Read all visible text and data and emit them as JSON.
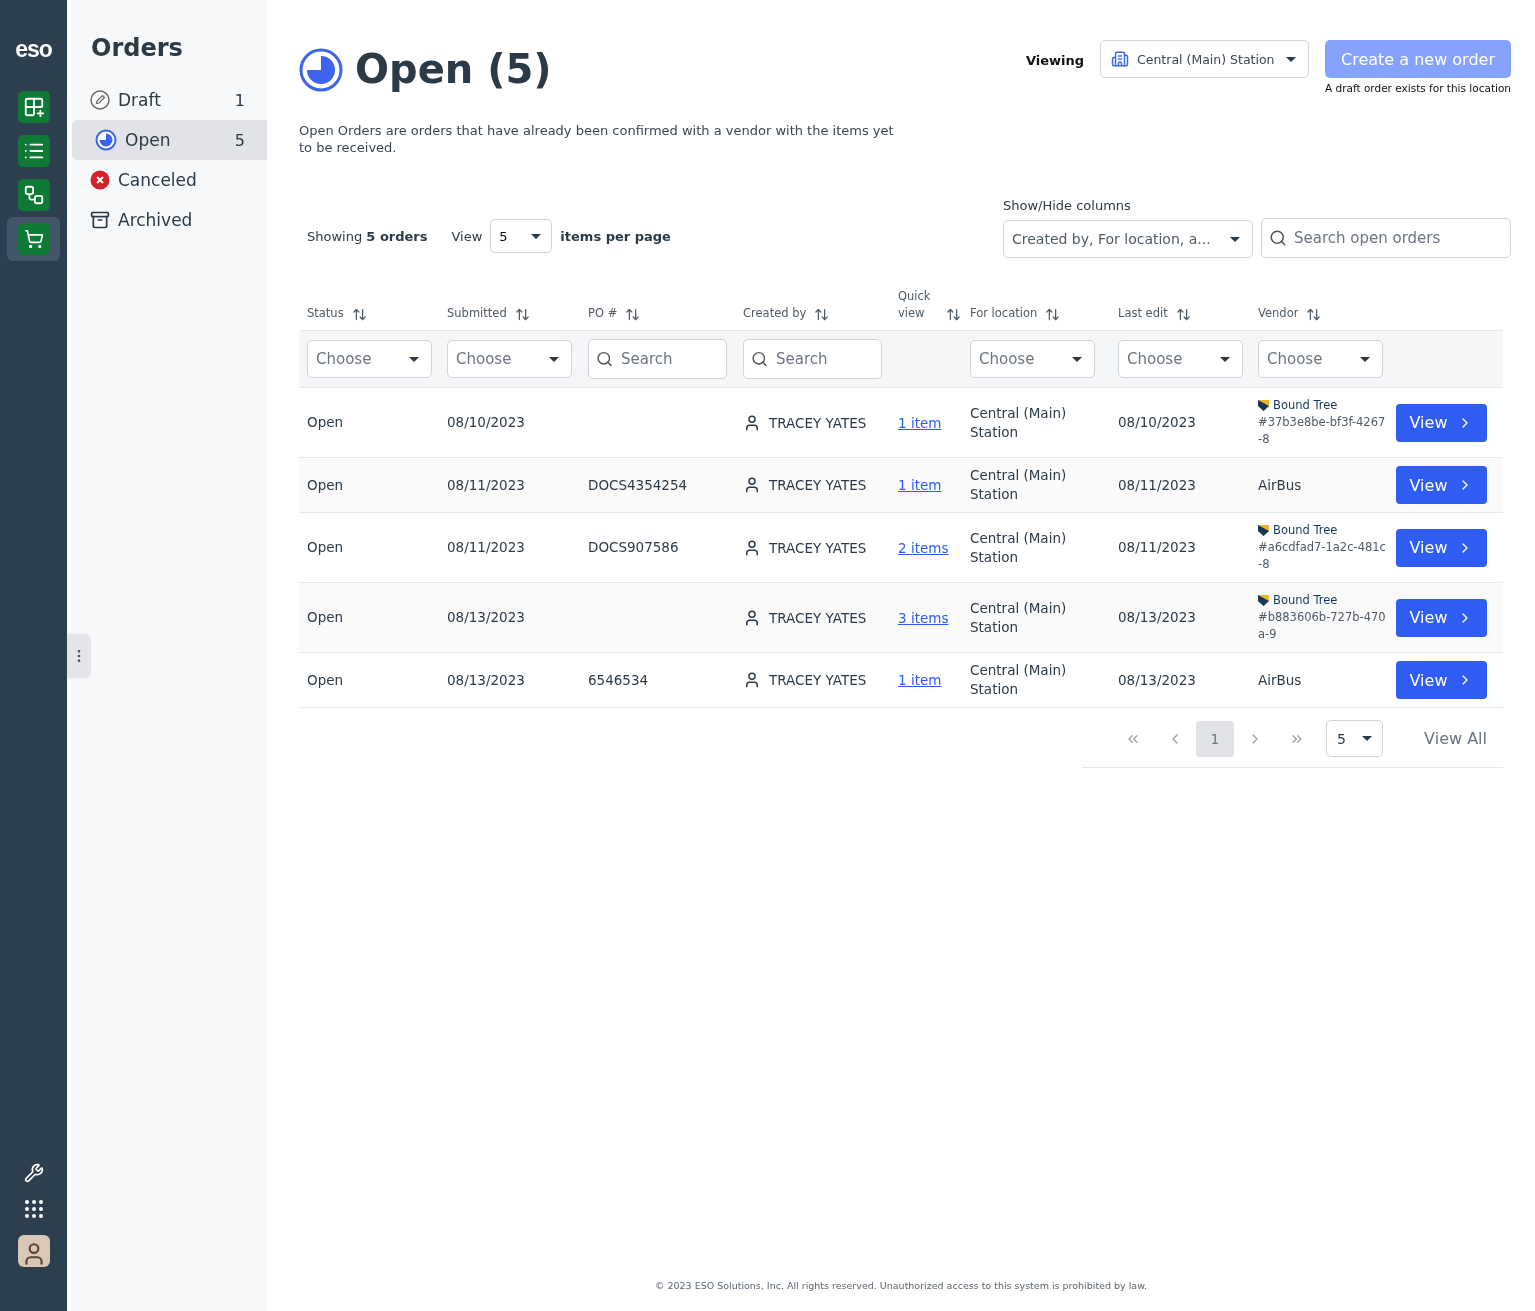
{
  "rail": {
    "logo": "eso",
    "apps": [
      {
        "kind": "grid",
        "selected": false
      },
      {
        "kind": "list",
        "selected": false
      },
      {
        "kind": "flow",
        "selected": false
      },
      {
        "kind": "cart",
        "selected": true
      }
    ]
  },
  "sidebar": {
    "title": "Orders",
    "items": [
      {
        "kind": "draft",
        "label": "Draft",
        "count": "1",
        "selected": false
      },
      {
        "kind": "open",
        "label": "Open",
        "count": "5",
        "selected": true
      },
      {
        "kind": "canceled",
        "label": "Canceled",
        "selected": false
      },
      {
        "kind": "archived",
        "label": "Archived",
        "selected": false
      }
    ]
  },
  "header": {
    "title": "Open (5)",
    "viewing_label": "Viewing",
    "location": "Central (Main) Station",
    "create_button": "Create a new order",
    "create_disabled": true,
    "create_note": "A draft order exists for this location"
  },
  "description": "Open Orders are orders that have already been confirmed with a vendor with the items yet to be received.",
  "toolbar": {
    "showing": "Showing **5 orders**",
    "view_label": "View",
    "per_page": "5",
    "per_page_suffix": "items per page",
    "columns_label": "Show/Hide columns",
    "columns_value": "Created by, For location, a...",
    "search_placeholder": "Search open orders"
  },
  "table": {
    "columns": [
      {
        "label": "Status",
        "filter": {
          "kind": "select",
          "placeholder": "Choose"
        }
      },
      {
        "label": "Submitted",
        "filter": {
          "kind": "select",
          "placeholder": "Choose"
        }
      },
      {
        "label": "PO #",
        "filter": {
          "kind": "search",
          "placeholder": "Search"
        }
      },
      {
        "label": "Created by",
        "filter": {
          "kind": "search",
          "placeholder": "Search"
        }
      },
      {
        "label": "Quick view"
      },
      {
        "label": "For location",
        "filter": {
          "kind": "select",
          "placeholder": "Choose"
        }
      },
      {
        "label": "Last edit",
        "filter": {
          "kind": "select",
          "placeholder": "Choose"
        }
      },
      {
        "label": "Vendor",
        "filter": {
          "kind": "select",
          "placeholder": "Choose"
        }
      }
    ],
    "rows": [
      {
        "status": "Open",
        "submitted": "08/10/2023",
        "created_by": "TRACEY YATES",
        "quick_view": "1 item",
        "location": "Central (Main) Station",
        "last_edit": "08/10/2023",
        "vendor": {
          "kind": "logo",
          "name": "Bound Tree",
          "id": "#37b3e8be-bf3f-4267-8"
        },
        "action": "View"
      },
      {
        "status": "Open",
        "submitted": "08/11/2023",
        "po": "DOCS4354254",
        "created_by": "TRACEY YATES",
        "quick_view": "1 item",
        "location": "Central (Main) Station",
        "last_edit": "08/11/2023",
        "vendor": {
          "kind": "plain",
          "name": "AirBus"
        },
        "action": "View"
      },
      {
        "status": "Open",
        "submitted": "08/11/2023",
        "po": "DOCS907586",
        "created_by": "TRACEY YATES",
        "quick_view": "2 items",
        "location": "Central (Main) Station",
        "last_edit": "08/11/2023",
        "vendor": {
          "kind": "logo",
          "name": "Bound Tree",
          "id": "#a6cdfad7-1a2c-481c-8"
        },
        "action": "View"
      },
      {
        "status": "Open",
        "submitted": "08/13/2023",
        "created_by": "TRACEY YATES",
        "quick_view": "3 items",
        "location": "Central (Main) Station",
        "last_edit": "08/13/2023",
        "vendor": {
          "kind": "logo",
          "name": "Bound Tree",
          "id": "#b883606b-727b-470a-9"
        },
        "action": "View"
      },
      {
        "status": "Open",
        "submitted": "08/13/2023",
        "po": "6546534",
        "created_by": "TRACEY YATES",
        "quick_view": "1 item",
        "location": "Central (Main) Station",
        "last_edit": "08/13/2023",
        "vendor": {
          "kind": "plain",
          "name": "AirBus"
        },
        "action": "View"
      }
    ]
  },
  "pagination": {
    "pages": [
      {
        "label": "1",
        "selected": true
      }
    ],
    "page_size": "5",
    "view_all": "View All"
  },
  "footer": "© 2023 ESO Solutions, Inc. All rights reserved. Unauthorized access to this system is prohibited by law."
}
